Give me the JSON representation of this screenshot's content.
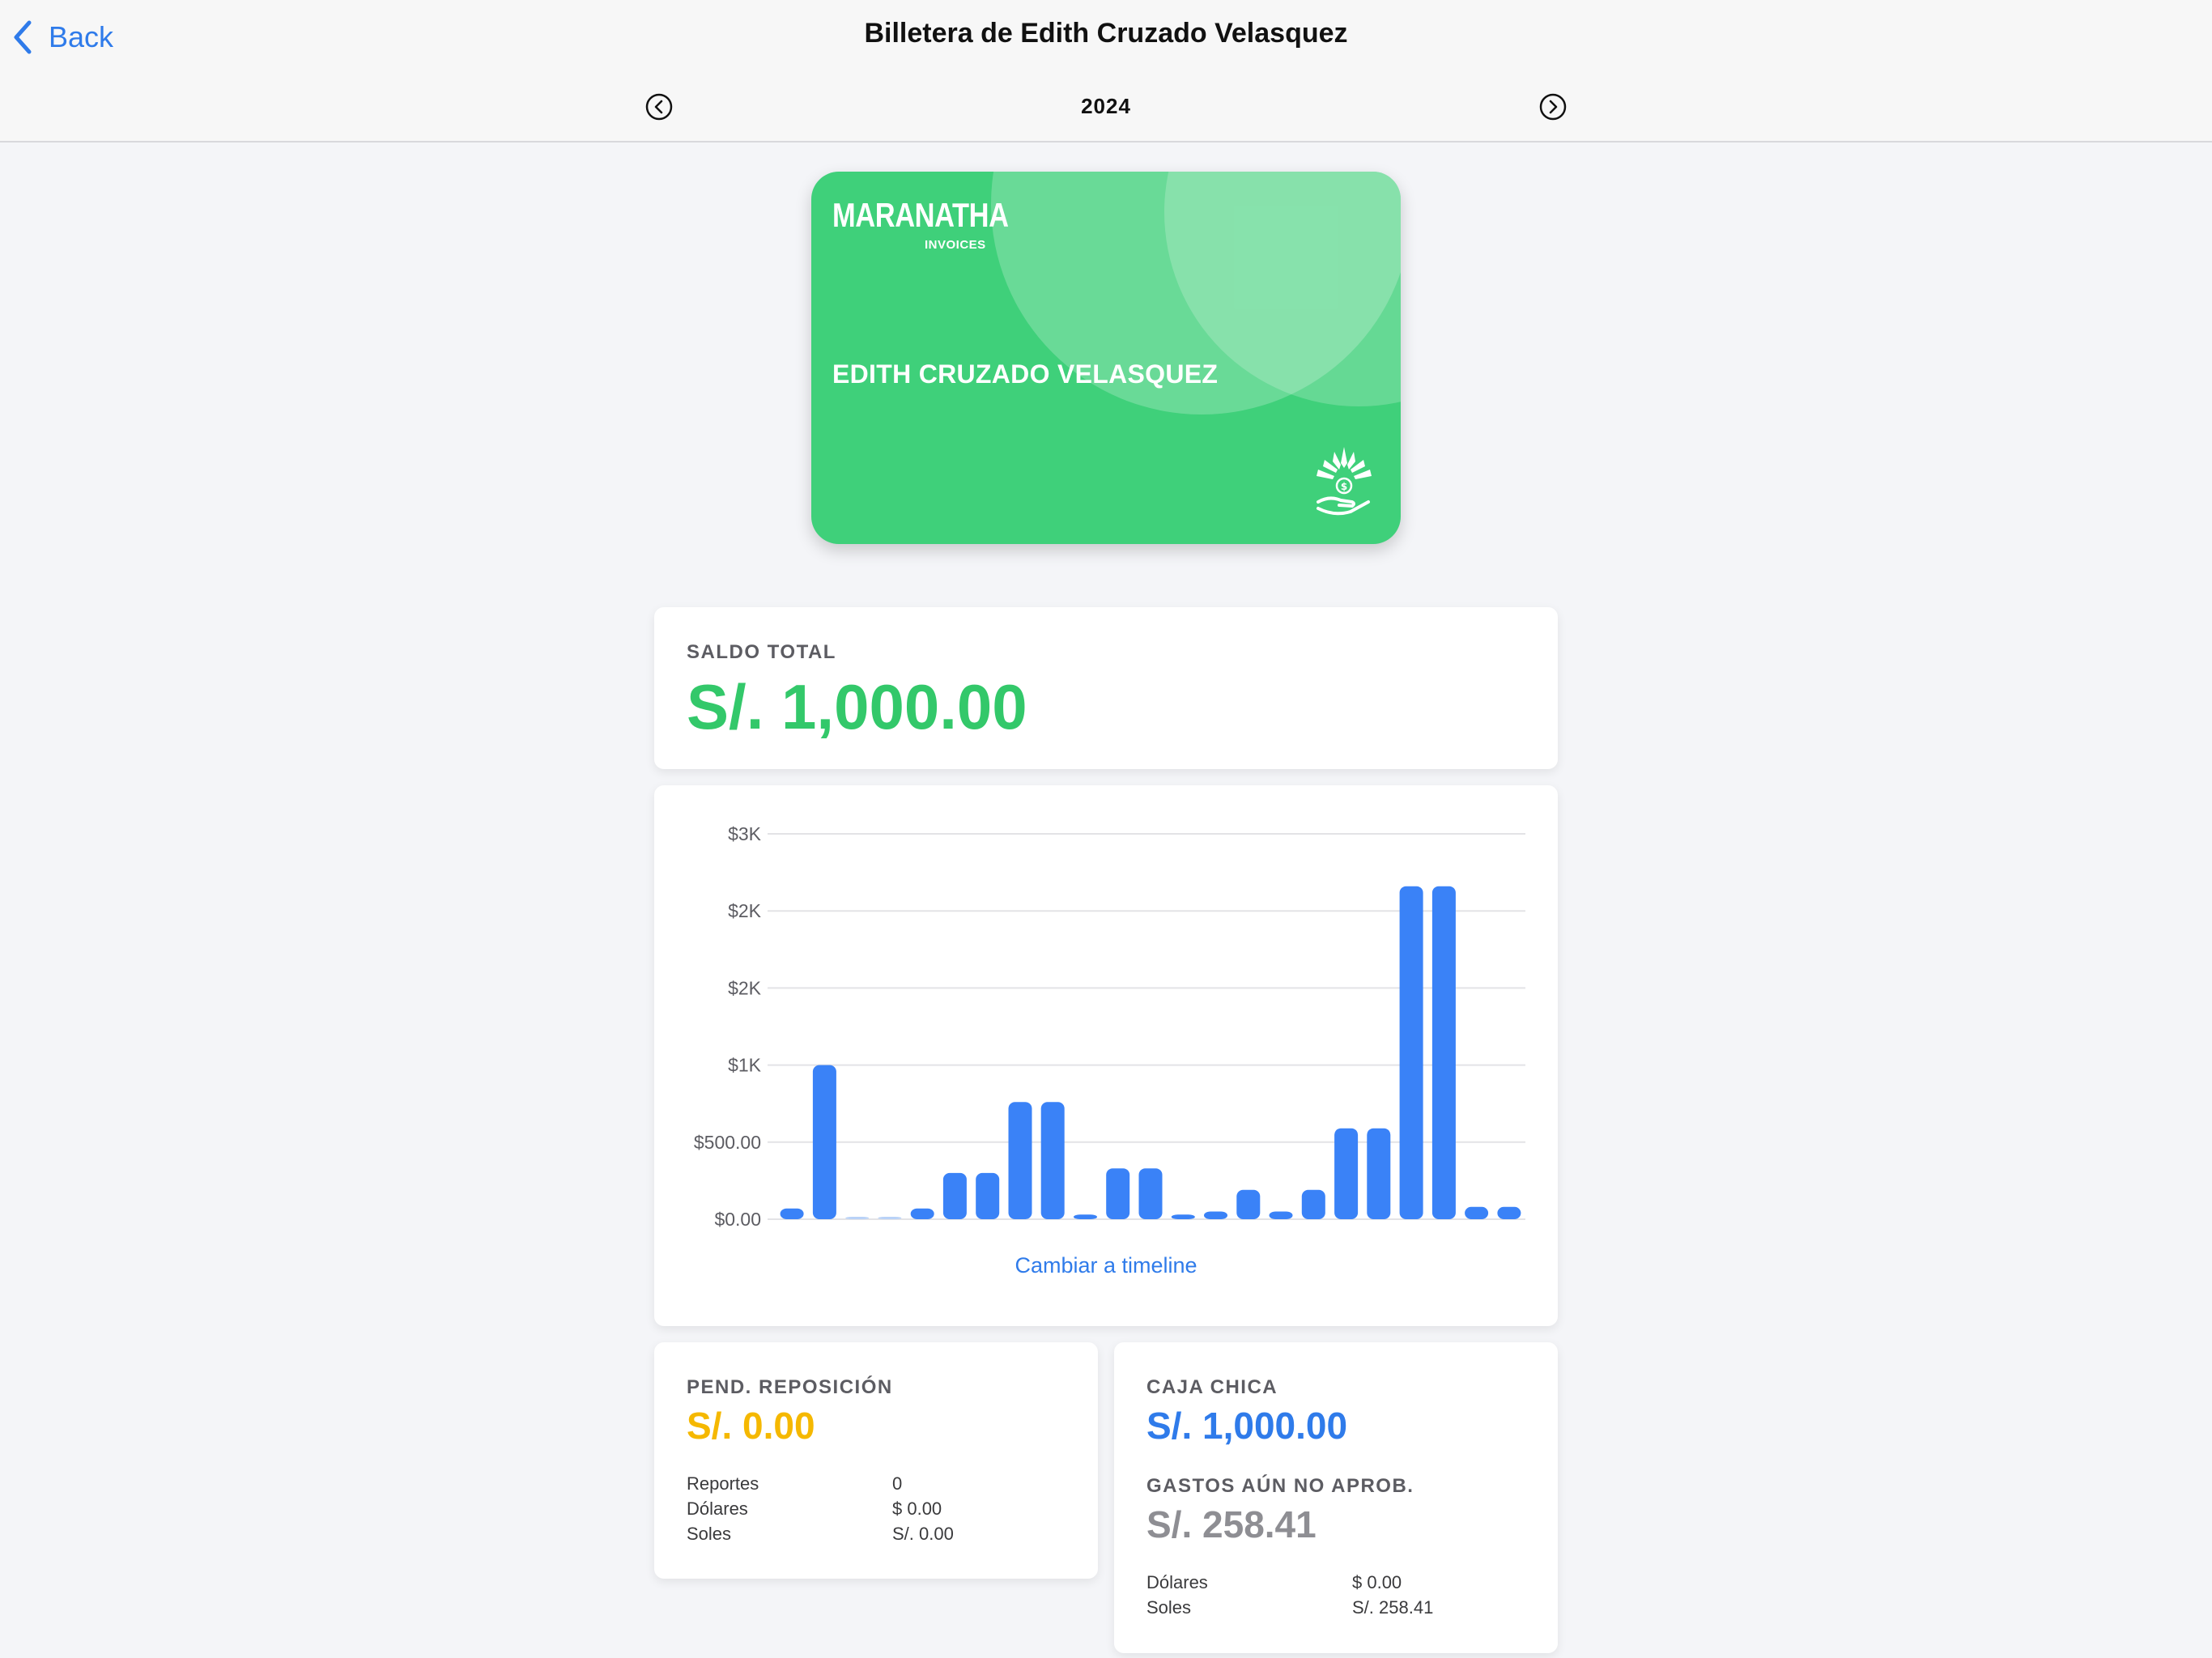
{
  "header": {
    "back_label": "Back",
    "title": "Billetera de Edith Cruzado Velasquez",
    "year": "2024",
    "prev_icon": "chevron-left-circle-icon",
    "next_icon": "chevron-right-circle-icon"
  },
  "card": {
    "brand": "MARANATHA",
    "brand_sub": "INVOICES",
    "holder": "EDITH CRUZADO VELASQUEZ",
    "color": "#3fd07a"
  },
  "balance": {
    "label": "SALDO TOTAL",
    "value": "S/. 1,000.00",
    "color": "#33c86a"
  },
  "chart_data": {
    "type": "bar",
    "y_tick_labels": [
      "$0.00",
      "$500.00",
      "$1K",
      "$2K",
      "$2K",
      "$3K"
    ],
    "ylim": [
      0,
      2500
    ],
    "grid": true,
    "values": [
      70,
      1000,
      10,
      10,
      70,
      300,
      300,
      760,
      760,
      30,
      330,
      330,
      30,
      50,
      190,
      50,
      190,
      590,
      590,
      2160,
      2160,
      80,
      80
    ],
    "bar_color": "#3a82f7",
    "toggle_label": "Cambiar a timeline"
  },
  "pending": {
    "label": "PEND. REPOSICIÓN",
    "value": "S/. 0.00",
    "color": "#f5b800",
    "rows": [
      {
        "key": "Reportes",
        "value": "0"
      },
      {
        "key": "Dólares",
        "value": "$ 0.00"
      },
      {
        "key": "Soles",
        "value": "S/. 0.00"
      }
    ]
  },
  "caja": {
    "label": "CAJA CHICA",
    "value": "S/. 1,000.00",
    "gastos_label": "GASTOS AÚN NO APROB.",
    "gastos_value": "S/. 258.41",
    "rows": [
      {
        "key": "Dólares",
        "value": "$ 0.00"
      },
      {
        "key": "Soles",
        "value": "S/. 258.41"
      }
    ]
  }
}
